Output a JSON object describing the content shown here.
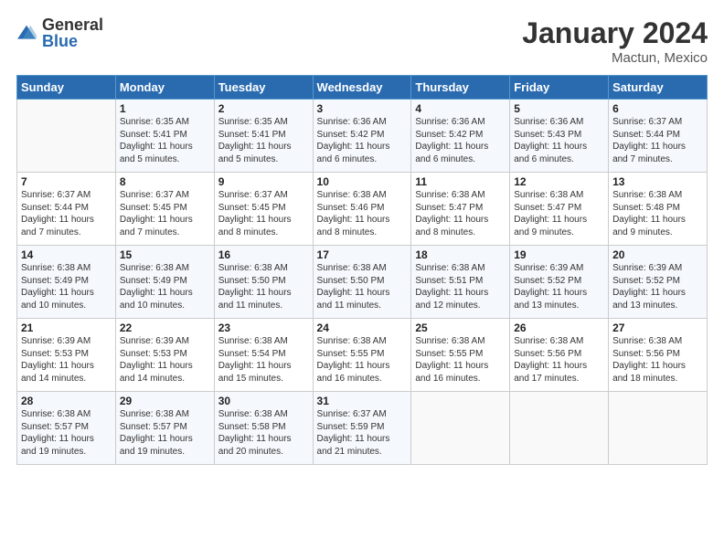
{
  "header": {
    "logo_general": "General",
    "logo_blue": "Blue",
    "month_title": "January 2024",
    "location": "Mactun, Mexico"
  },
  "days_of_week": [
    "Sunday",
    "Monday",
    "Tuesday",
    "Wednesday",
    "Thursday",
    "Friday",
    "Saturday"
  ],
  "weeks": [
    [
      {
        "day": "",
        "sunrise": "",
        "sunset": "",
        "daylight": ""
      },
      {
        "day": "1",
        "sunrise": "Sunrise: 6:35 AM",
        "sunset": "Sunset: 5:41 PM",
        "daylight": "Daylight: 11 hours and 5 minutes."
      },
      {
        "day": "2",
        "sunrise": "Sunrise: 6:35 AM",
        "sunset": "Sunset: 5:41 PM",
        "daylight": "Daylight: 11 hours and 5 minutes."
      },
      {
        "day": "3",
        "sunrise": "Sunrise: 6:36 AM",
        "sunset": "Sunset: 5:42 PM",
        "daylight": "Daylight: 11 hours and 6 minutes."
      },
      {
        "day": "4",
        "sunrise": "Sunrise: 6:36 AM",
        "sunset": "Sunset: 5:42 PM",
        "daylight": "Daylight: 11 hours and 6 minutes."
      },
      {
        "day": "5",
        "sunrise": "Sunrise: 6:36 AM",
        "sunset": "Sunset: 5:43 PM",
        "daylight": "Daylight: 11 hours and 6 minutes."
      },
      {
        "day": "6",
        "sunrise": "Sunrise: 6:37 AM",
        "sunset": "Sunset: 5:44 PM",
        "daylight": "Daylight: 11 hours and 7 minutes."
      }
    ],
    [
      {
        "day": "7",
        "sunrise": "Sunrise: 6:37 AM",
        "sunset": "Sunset: 5:44 PM",
        "daylight": "Daylight: 11 hours and 7 minutes."
      },
      {
        "day": "8",
        "sunrise": "Sunrise: 6:37 AM",
        "sunset": "Sunset: 5:45 PM",
        "daylight": "Daylight: 11 hours and 7 minutes."
      },
      {
        "day": "9",
        "sunrise": "Sunrise: 6:37 AM",
        "sunset": "Sunset: 5:45 PM",
        "daylight": "Daylight: 11 hours and 8 minutes."
      },
      {
        "day": "10",
        "sunrise": "Sunrise: 6:38 AM",
        "sunset": "Sunset: 5:46 PM",
        "daylight": "Daylight: 11 hours and 8 minutes."
      },
      {
        "day": "11",
        "sunrise": "Sunrise: 6:38 AM",
        "sunset": "Sunset: 5:47 PM",
        "daylight": "Daylight: 11 hours and 8 minutes."
      },
      {
        "day": "12",
        "sunrise": "Sunrise: 6:38 AM",
        "sunset": "Sunset: 5:47 PM",
        "daylight": "Daylight: 11 hours and 9 minutes."
      },
      {
        "day": "13",
        "sunrise": "Sunrise: 6:38 AM",
        "sunset": "Sunset: 5:48 PM",
        "daylight": "Daylight: 11 hours and 9 minutes."
      }
    ],
    [
      {
        "day": "14",
        "sunrise": "Sunrise: 6:38 AM",
        "sunset": "Sunset: 5:49 PM",
        "daylight": "Daylight: 11 hours and 10 minutes."
      },
      {
        "day": "15",
        "sunrise": "Sunrise: 6:38 AM",
        "sunset": "Sunset: 5:49 PM",
        "daylight": "Daylight: 11 hours and 10 minutes."
      },
      {
        "day": "16",
        "sunrise": "Sunrise: 6:38 AM",
        "sunset": "Sunset: 5:50 PM",
        "daylight": "Daylight: 11 hours and 11 minutes."
      },
      {
        "day": "17",
        "sunrise": "Sunrise: 6:38 AM",
        "sunset": "Sunset: 5:50 PM",
        "daylight": "Daylight: 11 hours and 11 minutes."
      },
      {
        "day": "18",
        "sunrise": "Sunrise: 6:38 AM",
        "sunset": "Sunset: 5:51 PM",
        "daylight": "Daylight: 11 hours and 12 minutes."
      },
      {
        "day": "19",
        "sunrise": "Sunrise: 6:39 AM",
        "sunset": "Sunset: 5:52 PM",
        "daylight": "Daylight: 11 hours and 13 minutes."
      },
      {
        "day": "20",
        "sunrise": "Sunrise: 6:39 AM",
        "sunset": "Sunset: 5:52 PM",
        "daylight": "Daylight: 11 hours and 13 minutes."
      }
    ],
    [
      {
        "day": "21",
        "sunrise": "Sunrise: 6:39 AM",
        "sunset": "Sunset: 5:53 PM",
        "daylight": "Daylight: 11 hours and 14 minutes."
      },
      {
        "day": "22",
        "sunrise": "Sunrise: 6:39 AM",
        "sunset": "Sunset: 5:53 PM",
        "daylight": "Daylight: 11 hours and 14 minutes."
      },
      {
        "day": "23",
        "sunrise": "Sunrise: 6:38 AM",
        "sunset": "Sunset: 5:54 PM",
        "daylight": "Daylight: 11 hours and 15 minutes."
      },
      {
        "day": "24",
        "sunrise": "Sunrise: 6:38 AM",
        "sunset": "Sunset: 5:55 PM",
        "daylight": "Daylight: 11 hours and 16 minutes."
      },
      {
        "day": "25",
        "sunrise": "Sunrise: 6:38 AM",
        "sunset": "Sunset: 5:55 PM",
        "daylight": "Daylight: 11 hours and 16 minutes."
      },
      {
        "day": "26",
        "sunrise": "Sunrise: 6:38 AM",
        "sunset": "Sunset: 5:56 PM",
        "daylight": "Daylight: 11 hours and 17 minutes."
      },
      {
        "day": "27",
        "sunrise": "Sunrise: 6:38 AM",
        "sunset": "Sunset: 5:56 PM",
        "daylight": "Daylight: 11 hours and 18 minutes."
      }
    ],
    [
      {
        "day": "28",
        "sunrise": "Sunrise: 6:38 AM",
        "sunset": "Sunset: 5:57 PM",
        "daylight": "Daylight: 11 hours and 19 minutes."
      },
      {
        "day": "29",
        "sunrise": "Sunrise: 6:38 AM",
        "sunset": "Sunset: 5:57 PM",
        "daylight": "Daylight: 11 hours and 19 minutes."
      },
      {
        "day": "30",
        "sunrise": "Sunrise: 6:38 AM",
        "sunset": "Sunset: 5:58 PM",
        "daylight": "Daylight: 11 hours and 20 minutes."
      },
      {
        "day": "31",
        "sunrise": "Sunrise: 6:37 AM",
        "sunset": "Sunset: 5:59 PM",
        "daylight": "Daylight: 11 hours and 21 minutes."
      },
      {
        "day": "",
        "sunrise": "",
        "sunset": "",
        "daylight": ""
      },
      {
        "day": "",
        "sunrise": "",
        "sunset": "",
        "daylight": ""
      },
      {
        "day": "",
        "sunrise": "",
        "sunset": "",
        "daylight": ""
      }
    ]
  ]
}
